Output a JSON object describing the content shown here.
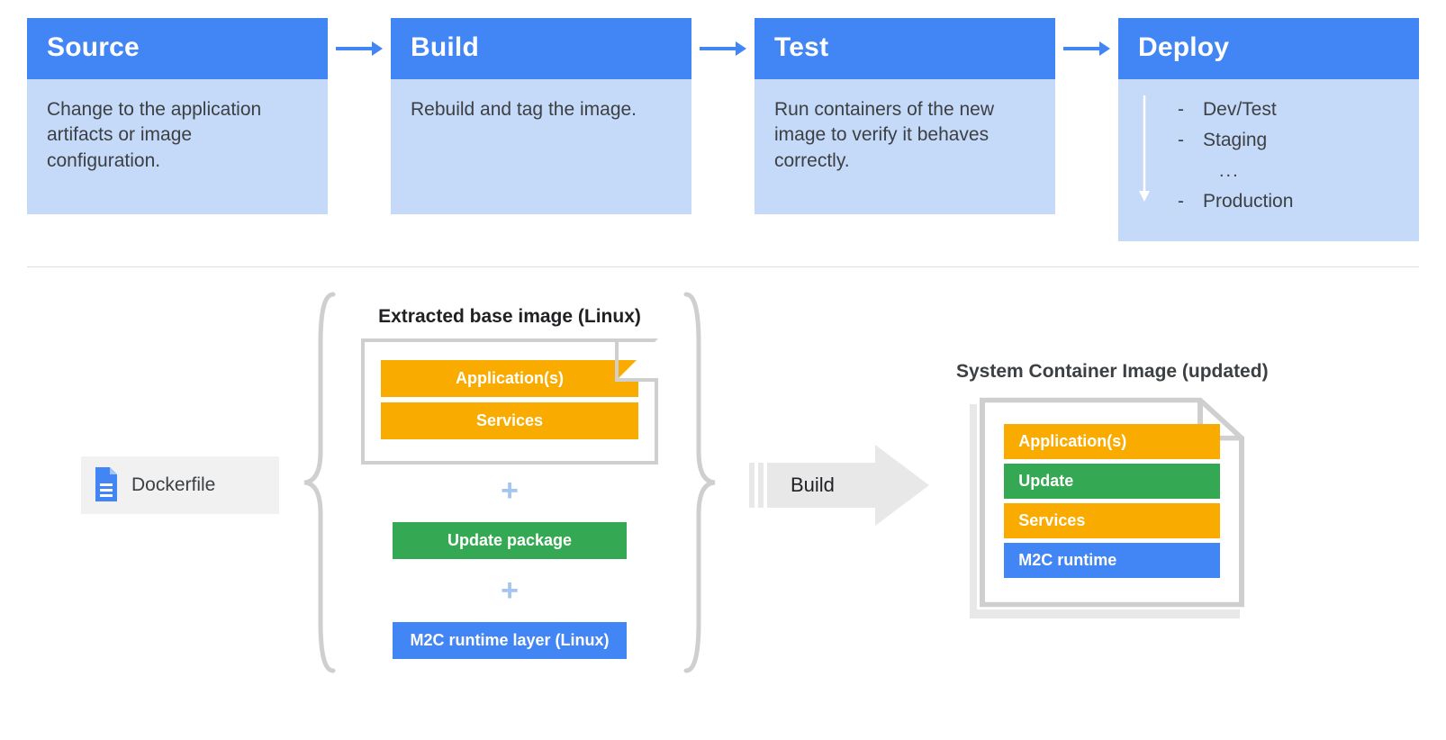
{
  "pipeline": {
    "stages": [
      {
        "title": "Source",
        "body": "Change to the application artifacts or image configuration."
      },
      {
        "title": "Build",
        "body": "Rebuild and tag the image."
      },
      {
        "title": "Test",
        "body": "Run containers of the new image to verify it behaves correctly."
      },
      {
        "title": "Deploy"
      }
    ],
    "deploy_items": [
      "Dev/Test",
      "Staging",
      "Production"
    ],
    "deploy_ellipsis": "..."
  },
  "dockerfile": {
    "label": "Dockerfile"
  },
  "center": {
    "title": "Extracted base image (Linux)",
    "linux_bars": {
      "apps": "Application(s)",
      "services": "Services"
    },
    "update_bar": "Update package",
    "runtime_bar": "M2C runtime layer (Linux)"
  },
  "build_arrow_label": "Build",
  "right": {
    "title": "System Container Image (updated)",
    "bars": {
      "apps": "Application(s)",
      "update": "Update",
      "services": "Services",
      "runtime": "M2C runtime"
    }
  },
  "colors": {
    "blue": "#4285f4",
    "yellow": "#f9ab00",
    "green": "#34a853"
  }
}
